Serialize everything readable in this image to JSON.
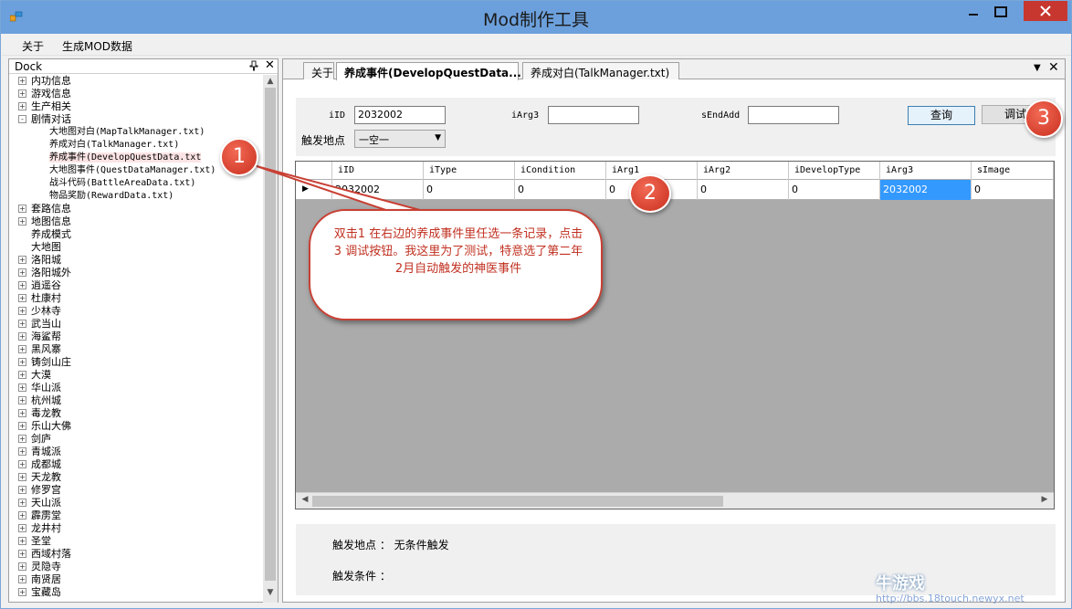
{
  "window": {
    "title": "Mod制作工具",
    "minimize_label": "—",
    "maximize_label": "☐",
    "close_label": "✕"
  },
  "menu": {
    "items": [
      "关于",
      "生成MOD数据"
    ]
  },
  "dock": {
    "title": "Dock",
    "pin": "ᵖ",
    "close": "✕",
    "tree": [
      {
        "label": "内功信息",
        "expander": "+",
        "indent": 0
      },
      {
        "label": "游戏信息",
        "expander": "+",
        "indent": 0
      },
      {
        "label": "生产相关",
        "expander": "+",
        "indent": 0
      },
      {
        "label": "剧情对话",
        "expander": "-",
        "indent": 0
      },
      {
        "label": "大地图对白(MapTalkManager.txt)",
        "indent": 1
      },
      {
        "label": "养成对白(TalkManager.txt)",
        "indent": 1
      },
      {
        "label": "养成事件(DevelopQuestData.txt",
        "indent": 1,
        "selected": true
      },
      {
        "label": "大地图事件(QuestDataManager.txt)",
        "indent": 1
      },
      {
        "label": "战斗代码(BattleAreaData.txt)",
        "indent": 1
      },
      {
        "label": "物品奖励(RewardData.txt)",
        "indent": 1
      },
      {
        "label": "套路信息",
        "expander": "+",
        "indent": 0
      },
      {
        "label": "地图信息",
        "expander": "+",
        "indent": 0
      },
      {
        "label": "养成模式",
        "indent": 0
      },
      {
        "label": "大地图",
        "indent": 0
      },
      {
        "label": "洛阳城",
        "expander": "+",
        "indent": 0
      },
      {
        "label": "洛阳城外",
        "expander": "+",
        "indent": 0
      },
      {
        "label": "逍遥谷",
        "expander": "+",
        "indent": 0
      },
      {
        "label": "杜康村",
        "expander": "+",
        "indent": 0
      },
      {
        "label": "少林寺",
        "expander": "+",
        "indent": 0
      },
      {
        "label": "武当山",
        "expander": "+",
        "indent": 0
      },
      {
        "label": "海鲨帮",
        "expander": "+",
        "indent": 0
      },
      {
        "label": "黑风寨",
        "expander": "+",
        "indent": 0
      },
      {
        "label": "铸剑山庄",
        "expander": "+",
        "indent": 0
      },
      {
        "label": "大漠",
        "expander": "+",
        "indent": 0
      },
      {
        "label": "华山派",
        "expander": "+",
        "indent": 0
      },
      {
        "label": "杭州城",
        "expander": "+",
        "indent": 0
      },
      {
        "label": "毒龙教",
        "expander": "+",
        "indent": 0
      },
      {
        "label": "乐山大佛",
        "expander": "+",
        "indent": 0
      },
      {
        "label": "剑庐",
        "expander": "+",
        "indent": 0
      },
      {
        "label": "青城派",
        "expander": "+",
        "indent": 0
      },
      {
        "label": "成都城",
        "expander": "+",
        "indent": 0
      },
      {
        "label": "天龙教",
        "expander": "+",
        "indent": 0
      },
      {
        "label": "修罗宫",
        "expander": "+",
        "indent": 0
      },
      {
        "label": "天山派",
        "expander": "+",
        "indent": 0
      },
      {
        "label": "霹雳堂",
        "expander": "+",
        "indent": 0
      },
      {
        "label": "龙井村",
        "expander": "+",
        "indent": 0
      },
      {
        "label": "圣堂",
        "expander": "+",
        "indent": 0
      },
      {
        "label": "西域村落",
        "expander": "+",
        "indent": 0
      },
      {
        "label": "灵隐寺",
        "expander": "+",
        "indent": 0
      },
      {
        "label": "南贤居",
        "expander": "+",
        "indent": 0
      },
      {
        "label": "宝藏岛",
        "expander": "+",
        "indent": 0
      }
    ]
  },
  "tabs": {
    "items": [
      "关于",
      "养成事件(DevelopQuestData....",
      "养成对白(TalkManager.txt)"
    ],
    "active_index": 1,
    "menu": "▼",
    "close": "✕"
  },
  "form": {
    "iid_label": "iID",
    "iid_value": "2032002",
    "iarg3_label": "iArg3",
    "iarg3_value": "",
    "sendadd_label": "sEndAdd",
    "sendadd_value": "",
    "location_label": "触发地点",
    "location_value": "一空一",
    "query_button": "查询",
    "debug_button": "调试"
  },
  "grid": {
    "columns": [
      "iID",
      "iType",
      "iCondition",
      "iArg1",
      "iArg2",
      "iDevelopType",
      "iArg3",
      "sImage"
    ],
    "rows": [
      [
        "2032002",
        "0",
        "0",
        "0",
        "0",
        "0",
        "2032002",
        "0"
      ]
    ],
    "selected_col": 6,
    "row_marker": "▶"
  },
  "info": {
    "location_line": "触发地点 ： 无条件触发",
    "condition_line": "触发条件 ："
  },
  "annotations": {
    "num1": "1",
    "num2": "2",
    "num3": "3",
    "bubble_text": "双击1  在右边的养成事件里任选一条记录，点击 3 调试按钮。我这里为了测试，特意选了第二年2月自动触发的神医事件"
  },
  "watermark": {
    "brand": "牛游戏",
    "url": "http://bbs.18touch.newyx.net"
  },
  "colors": {
    "titlebar": "#6ca0dc",
    "annotation_red": "#c94034",
    "selection_blue": "#3399ff"
  }
}
